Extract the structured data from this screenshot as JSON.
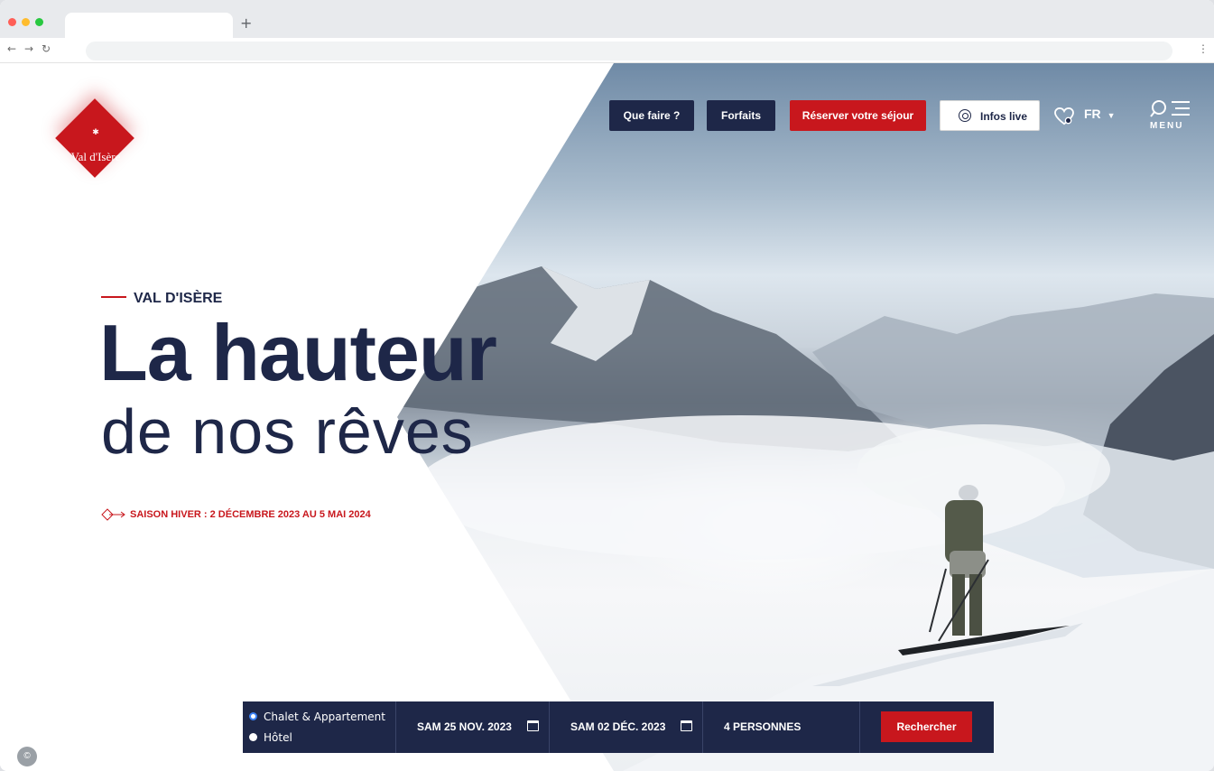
{
  "header": {
    "logo_text": "Val d'Isère",
    "nav": {
      "que_faire": "Que faire ?",
      "forfaits": "Forfaits",
      "reserver": "Réserver votre séjour",
      "infos_live": "Infos live"
    },
    "lang": "FR",
    "menu_label": "MENU"
  },
  "hero": {
    "kicker": "VAL D'ISÈRE",
    "title_line1": "La hauteur",
    "title_line2": "de nos rêves",
    "season": "SAISON HIVER : 2 DÉCEMBRE 2023 AU 5 MAI 2024"
  },
  "search": {
    "options": [
      {
        "label": "Chalet & Appartement",
        "selected": true
      },
      {
        "label": "Hôtel",
        "selected": false
      }
    ],
    "arrival": "SAM 25 NOV. 2023",
    "departure": "SAM 02 DÉC. 2023",
    "guests": "4 PERSONNES",
    "submit": "Rechercher"
  },
  "icons": {
    "browser": [
      "back-icon",
      "forward-icon",
      "reload-icon",
      "kebab-icon",
      "new-tab-icon"
    ],
    "page": [
      "location-icon",
      "heart-icon",
      "chevron-down-icon",
      "search-icon",
      "hamburger-icon",
      "calendar-icon",
      "arrow-icon",
      "cookie-icon"
    ]
  },
  "colors": {
    "navy": "#1e2748",
    "red": "#c8171d",
    "white": "#ffffff"
  }
}
